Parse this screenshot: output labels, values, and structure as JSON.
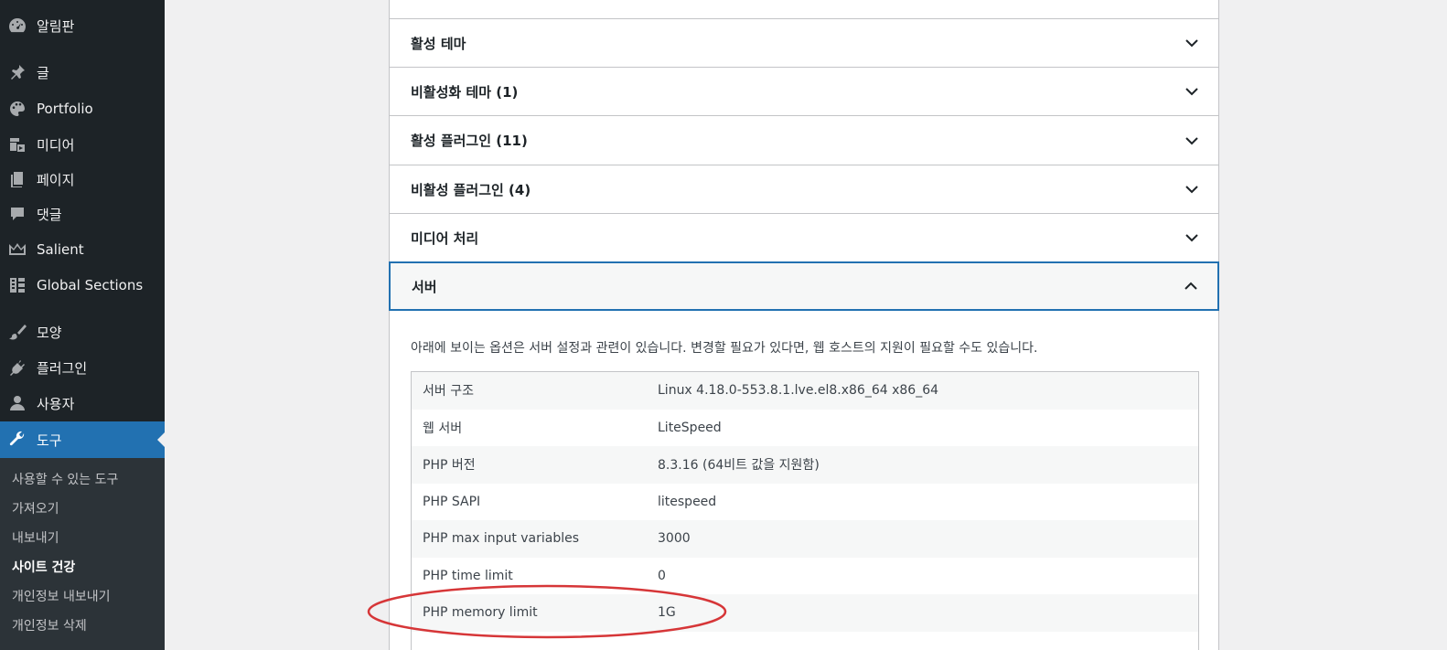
{
  "sidebar": {
    "items": [
      {
        "label": "알림판",
        "icon": "dashboard-icon"
      },
      {
        "label": "글",
        "icon": "pin-icon"
      },
      {
        "label": "Portfolio",
        "icon": "palette-icon"
      },
      {
        "label": "미디어",
        "icon": "media-icon"
      },
      {
        "label": "페이지",
        "icon": "page-icon"
      },
      {
        "label": "댓글",
        "icon": "comment-icon"
      },
      {
        "label": "Salient",
        "icon": "crown-icon"
      },
      {
        "label": "Global Sections",
        "icon": "layout-icon"
      },
      {
        "label": "모양",
        "icon": "brush-icon"
      },
      {
        "label": "플러그인",
        "icon": "plugin-icon"
      },
      {
        "label": "사용자",
        "icon": "user-icon"
      },
      {
        "label": "도구",
        "icon": "wrench-icon"
      }
    ],
    "submenu": [
      "사용할 수 있는 도구",
      "가져오기",
      "내보내기",
      "사이트 건강",
      "개인정보 내보내기",
      "개인정보 삭제"
    ]
  },
  "accordions": [
    {
      "label": "활성 테마"
    },
    {
      "label": "비활성화 테마 (1)"
    },
    {
      "label": "활성 플러그인 (11)"
    },
    {
      "label": "비활성 플러그인 (4)"
    },
    {
      "label": "미디어 처리"
    },
    {
      "label": "서버"
    }
  ],
  "server": {
    "description": "아래에 보이는 옵션은 서버 설정과 관련이 있습니다. 변경할 필요가 있다면, 웹 호스트의 지원이 필요할 수도 있습니다.",
    "rows": [
      {
        "key": "서버 구조",
        "value": "Linux 4.18.0-553.8.1.lve.el8.x86_64 x86_64"
      },
      {
        "key": "웹 서버",
        "value": "LiteSpeed"
      },
      {
        "key": "PHP 버전",
        "value": "8.3.16 (64비트 값을 지원함)"
      },
      {
        "key": "PHP SAPI",
        "value": "litespeed"
      },
      {
        "key": "PHP max input variables",
        "value": "3000"
      },
      {
        "key": "PHP time limit",
        "value": "0"
      },
      {
        "key": "PHP memory limit",
        "value": "1G"
      }
    ]
  },
  "colors": {
    "sidebar_bg": "#1d2327",
    "active_menu": "#2271b1",
    "highlight_ellipse": "#d63638"
  }
}
